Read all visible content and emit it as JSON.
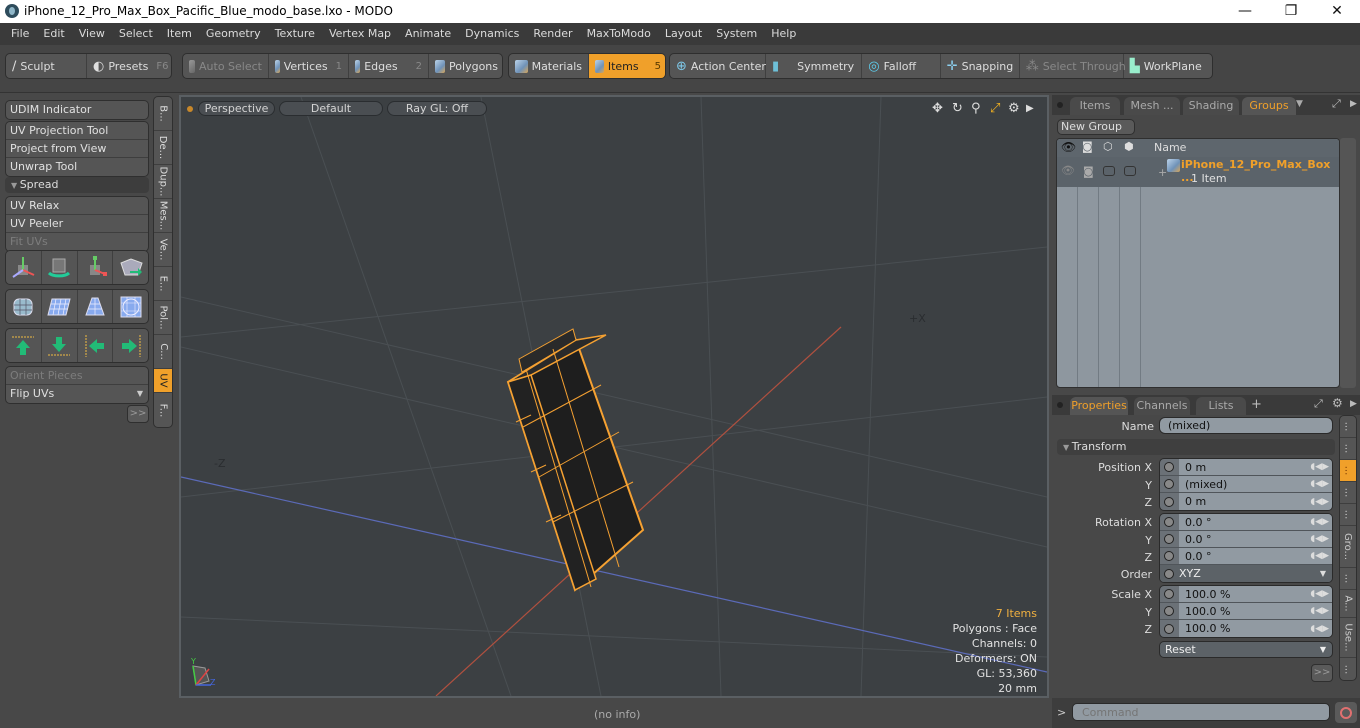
{
  "window": {
    "title": "iPhone_12_Pro_Max_Box_Pacific_Blue_modo_base.lxo - MODO",
    "minimize_icon": "—",
    "maximize_icon": "❐",
    "close_icon": "✕"
  },
  "menu": [
    "File",
    "Edit",
    "View",
    "Select",
    "Item",
    "Geometry",
    "Texture",
    "Vertex Map",
    "Animate",
    "Dynamics",
    "Render",
    "MaxToModo",
    "Layout",
    "System",
    "Help"
  ],
  "toolbar": {
    "sculpt": "Sculpt",
    "presets": "Presets",
    "presets_key": "F6",
    "auto_select": "Auto Select",
    "vertices": "Vertices",
    "vertices_key": "1",
    "edges": "Edges",
    "edges_key": "2",
    "polygons": "Polygons",
    "materials": "Materials",
    "items": "Items",
    "items_key": "5",
    "action_center": "Action Center",
    "symmetry": "Symmetry",
    "falloff": "Falloff",
    "snapping": "Snapping",
    "select_through": "Select Through",
    "workplane": "WorkPlane"
  },
  "left_panel": {
    "udim": "UDIM Indicator",
    "group1": [
      "UV Projection Tool",
      "Project from View",
      "Unwrap Tool"
    ],
    "spread_section": "Spread",
    "group2": [
      "UV Relax",
      "UV Peeler",
      "Fit UVs"
    ],
    "orient_pieces": "Orient Pieces",
    "flip_uvs": "Flip UVs",
    "more": ">>",
    "vertical_tabs": [
      "B...",
      "De...",
      "Dup...",
      "Mes...",
      "Ve...",
      "E...",
      "Pol...",
      "C...",
      "UV",
      "F..."
    ]
  },
  "viewport": {
    "view_mode": "Perspective",
    "shading": "Default",
    "raygl": "Ray GL: Off",
    "axis_neg_z": "-Z",
    "axis_pos_x": "+X",
    "hud": {
      "items": "7 Items",
      "polygons": "Polygons : Face",
      "channels": "Channels: 0",
      "deformers": "Deformers: ON",
      "gl": "GL: 53,360",
      "unit": "20 mm"
    }
  },
  "statusbar": {
    "info": "(no info)"
  },
  "right_panel": {
    "top_tabs": [
      "Items",
      "Mesh ...",
      "Shading",
      "Groups"
    ],
    "active_top_tab": "Groups",
    "new_group": "New Group",
    "list_header_name": "Name",
    "group_item": {
      "name": "iPhone_12_Pro_Max_Box ...",
      "count": "1 Item"
    },
    "bottom_tabs": [
      "Properties",
      "Channels",
      "Lists"
    ],
    "add_tab": "+",
    "properties": {
      "name_label": "Name",
      "name_value": "(mixed)",
      "transform_section": "Transform",
      "position": {
        "label": "Position X",
        "x": "0 m",
        "y": "(mixed)",
        "z": "0 m"
      },
      "rotation": {
        "label": "Rotation X",
        "x": "0.0 °",
        "y": "0.0 °",
        "z": "0.0 °"
      },
      "order": {
        "label": "Order",
        "value": "XYZ"
      },
      "scale": {
        "label": "Scale X",
        "x": "100.0 %",
        "y": "100.0 %",
        "z": "100.0 %"
      },
      "axis_y": "Y",
      "axis_z": "Z",
      "reset": "Reset",
      "more": ">>"
    },
    "side_tabs": [
      "...",
      "...",
      "...",
      "...",
      "...",
      "Gro...",
      "...",
      "A...",
      "Use...",
      "..."
    ],
    "command_placeholder": "Command",
    "command_prompt": ">"
  },
  "colors": {
    "accent": "#f0a02a",
    "viewport_bg": "#3c4043",
    "panel_bg": "#484848"
  }
}
